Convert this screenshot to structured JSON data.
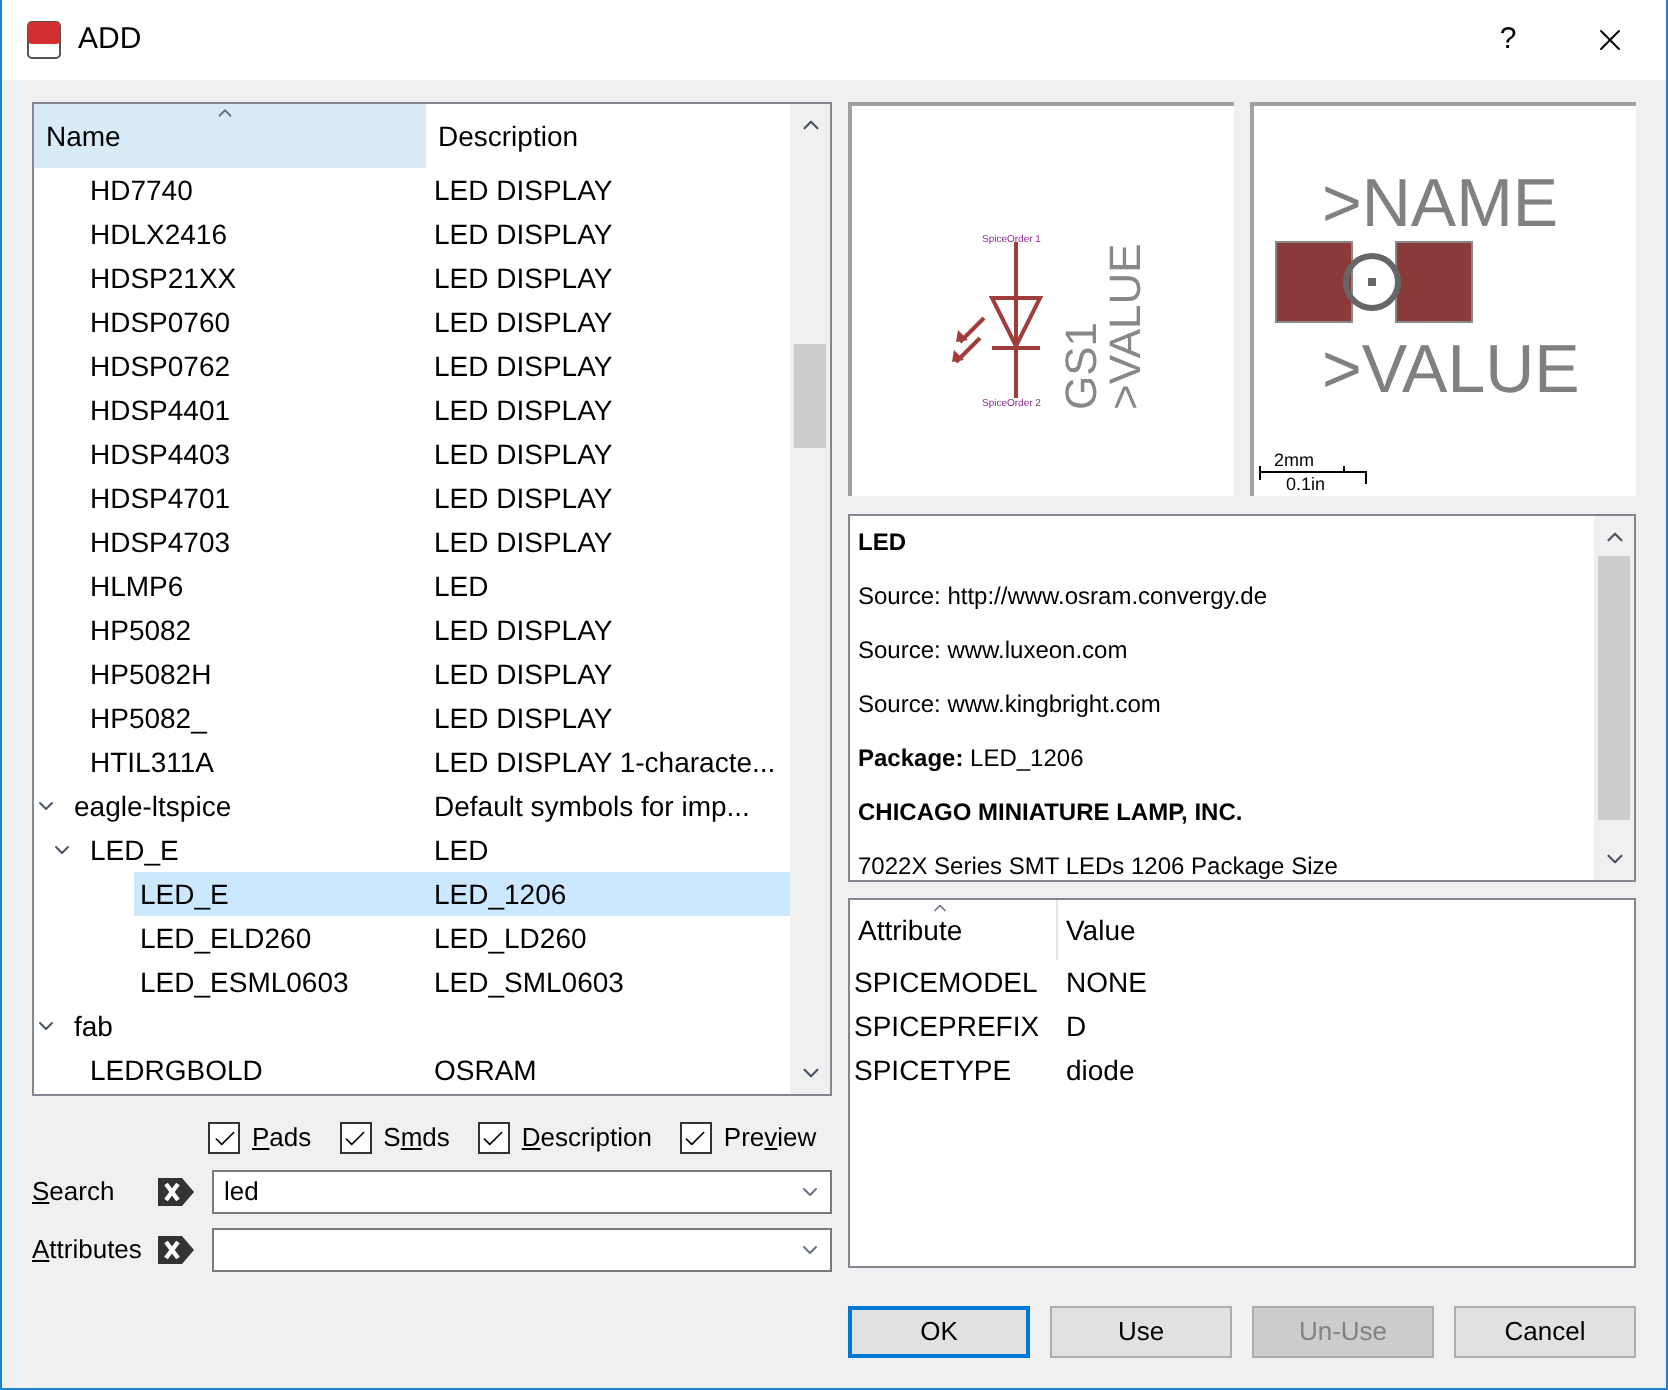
{
  "window": {
    "title": "ADD",
    "help": "?"
  },
  "tree": {
    "columns": [
      {
        "label": "Name",
        "sorted": true
      },
      {
        "label": "Description",
        "sorted": false
      }
    ],
    "items": [
      {
        "kind": "continuation",
        "children": [
          {
            "name": "HD7740",
            "description": "LED DISPLAY",
            "selected": false
          },
          {
            "name": "HDLX2416",
            "description": "LED DISPLAY",
            "selected": false
          },
          {
            "name": "HDSP21XX",
            "description": "LED DISPLAY",
            "selected": false
          },
          {
            "name": "HDSP0760",
            "description": "LED DISPLAY",
            "selected": false
          },
          {
            "name": "HDSP0762",
            "description": "LED DISPLAY",
            "selected": false
          },
          {
            "name": "HDSP4401",
            "description": "LED DISPLAY",
            "selected": false
          },
          {
            "name": "HDSP4403",
            "description": "LED DISPLAY",
            "selected": false
          },
          {
            "name": "HDSP4701",
            "description": "LED DISPLAY",
            "selected": false
          },
          {
            "name": "HDSP4703",
            "description": "LED DISPLAY",
            "selected": false
          },
          {
            "name": "HLMP6",
            "description": "LED",
            "selected": false
          },
          {
            "name": "HP5082",
            "description": "LED DISPLAY",
            "selected": false
          },
          {
            "name": "HP5082H",
            "description": "LED DISPLAY",
            "selected": false
          },
          {
            "name": "HP5082_",
            "description": "LED DISPLAY",
            "selected": false
          },
          {
            "name": "HTIL311A",
            "description": "LED DISPLAY  1-characte...",
            "selected": false
          }
        ]
      },
      {
        "name": "eagle-ltspice",
        "description": "Default symbols for imp...",
        "selected": false,
        "expanded": true,
        "children": [
          {
            "name": "LED_E",
            "description": "LED",
            "selected": false,
            "expanded": true,
            "children": [
              {
                "name": "LED_E",
                "description": "LED_1206",
                "selected": true
              },
              {
                "name": "LED_ELD260",
                "description": "LED_LD260",
                "selected": false
              },
              {
                "name": "LED_ESML0603",
                "description": "LED_SML0603",
                "selected": false
              }
            ]
          }
        ]
      },
      {
        "name": "fab",
        "selected": false,
        "expanded": true,
        "children": [
          {
            "name": "LEDRGBOLD",
            "description": "OSRAM",
            "selected": false
          }
        ]
      }
    ]
  },
  "filters": [
    {
      "label": {
        "key": "P",
        "after": "ads"
      },
      "checked": true
    },
    {
      "label": {
        "before": "S",
        "key": "m",
        "after": "ds"
      },
      "checked": true
    },
    {
      "label": {
        "key": "D",
        "after": "escription"
      },
      "checked": true
    },
    {
      "label": {
        "before": "Pre",
        "key": "v",
        "after": "iew"
      },
      "checked": true
    }
  ],
  "search": {
    "label": {
      "key": "S",
      "after": "earch"
    },
    "value": "led"
  },
  "attributes_filter": {
    "label": {
      "key": "A",
      "after": "ttributes"
    }
  },
  "symbol_preview": {
    "pin_labels": [
      "SpiceOrder 1",
      "SpiceOrder 2"
    ],
    "name_label": "GS1",
    "value_label": ">VALUE"
  },
  "package_preview": {
    "name_label": ">NAME",
    "value_label": ">VALUE",
    "scale": [
      "2mm",
      "0.1in"
    ]
  },
  "description": [
    {
      "kind": "heading",
      "text": "LED"
    },
    {
      "kind": "line",
      "text": "Source: http://www.osram.convergy.de"
    },
    {
      "kind": "line",
      "text": "Source: www.luxeon.com"
    },
    {
      "kind": "line",
      "text": "Source: www.kingbright.com"
    },
    {
      "kind": "line",
      "text": "**Package:** LED_1206"
    },
    {
      "kind": "heading",
      "text": "CHICAGO MINIATURE LAMP, INC."
    },
    {
      "kind": "line",
      "text": "7022X Series SMT LEDs 1206 Package Size"
    }
  ],
  "attributes": {
    "columns": [
      {
        "label": "Attribute",
        "sorted": true
      },
      {
        "label": "Value",
        "sorted": false
      }
    ],
    "rows": [
      {
        "attribute": "SPICEMODEL",
        "value": "NONE"
      },
      {
        "attribute": "SPICEPREFIX",
        "value": "D"
      },
      {
        "attribute": "SPICETYPE",
        "value": "diode"
      }
    ]
  },
  "buttons": [
    {
      "label": "OK",
      "default": true,
      "disabled": false
    },
    {
      "label": "Use",
      "default": false,
      "disabled": false
    },
    {
      "label": "Un-Use",
      "default": false,
      "disabled": true
    },
    {
      "label": "Cancel",
      "default": false,
      "disabled": false
    }
  ]
}
